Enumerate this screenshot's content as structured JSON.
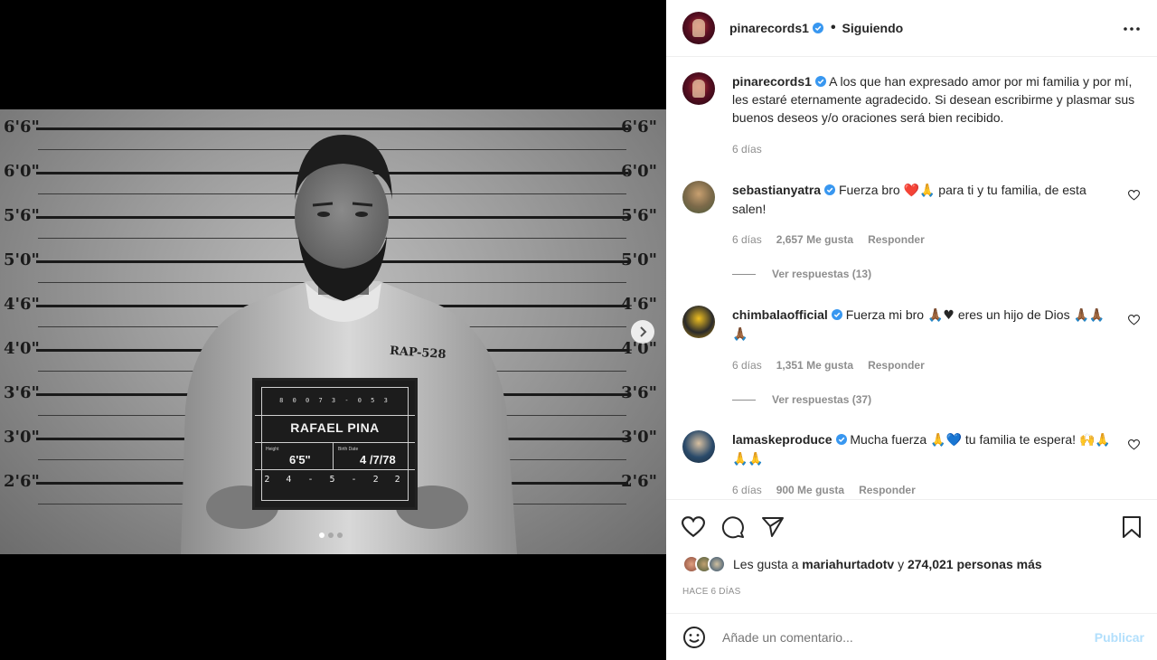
{
  "post": {
    "placard": {
      "code": "80073-053",
      "name": "RAFAEL PINA",
      "height_label": "Height",
      "height_value": "6'5\"",
      "birth_label": "Birth Date",
      "birth_value": "4 /7/78",
      "date": "24-5-22"
    },
    "shirt_tag": "RAP-528",
    "height_marks": [
      "6'6\"",
      "6'0\"",
      "5'6\"",
      "5'0\"",
      "4'6\"",
      "4'0\"",
      "3'6\"",
      "3'0\"",
      "2'6\""
    ],
    "carousel": {
      "total": 3,
      "active": 1
    }
  },
  "header": {
    "username": "pinarecords1",
    "follow_status": "Siguiendo",
    "separator": "•"
  },
  "caption": {
    "username": "pinarecords1",
    "text": "A los que han expresado amor por mi familia y por mí, les estaré eternamente agradecido. Si desean escribirme y plasmar sus buenos deseos y/o oraciones será bien recibido.",
    "time": "6 días"
  },
  "comments": [
    {
      "username": "sebastianyatra",
      "text_a": "Fuerza bro ",
      "emoji_a": "❤️🙏",
      "text_b": " para ti y tu familia, de esta salen!",
      "time": "6 días",
      "likes": "2,657 Me gusta",
      "reply": "Responder",
      "replies": "Ver respuestas (13)"
    },
    {
      "username": "chimbalaofficial",
      "text_a": "Fuerza mi bro ",
      "emoji_a": "🙏🏾♥",
      "text_b": " eres un hijo de Dios ",
      "emoji_b": "🙏🏾🙏🏾🙏🏾",
      "time": "6 días",
      "likes": "1,351 Me gusta",
      "reply": "Responder",
      "replies": "Ver respuestas (37)"
    },
    {
      "username": "lamaskeproduce",
      "text_a": "Mucha fuerza ",
      "emoji_a": "🙏💙",
      "text_b": " tu familia te espera! ",
      "emoji_b": "🙌🙏🙏🙏",
      "time": "6 días",
      "likes": "900 Me gusta",
      "reply": "Responder"
    }
  ],
  "likes": {
    "prefix": "Les gusta a",
    "user": "mariahurtadotv",
    "conj": "y",
    "others": "274,021 personas más"
  },
  "posted_ago": "HACE 6 DÍAS",
  "comment_box": {
    "placeholder": "Añade un comentario...",
    "post_label": "Publicar"
  },
  "colors": {
    "verified": "#3897f0",
    "publish_disabled": "#b2dffc",
    "secondary_text": "#8e8e8e"
  }
}
